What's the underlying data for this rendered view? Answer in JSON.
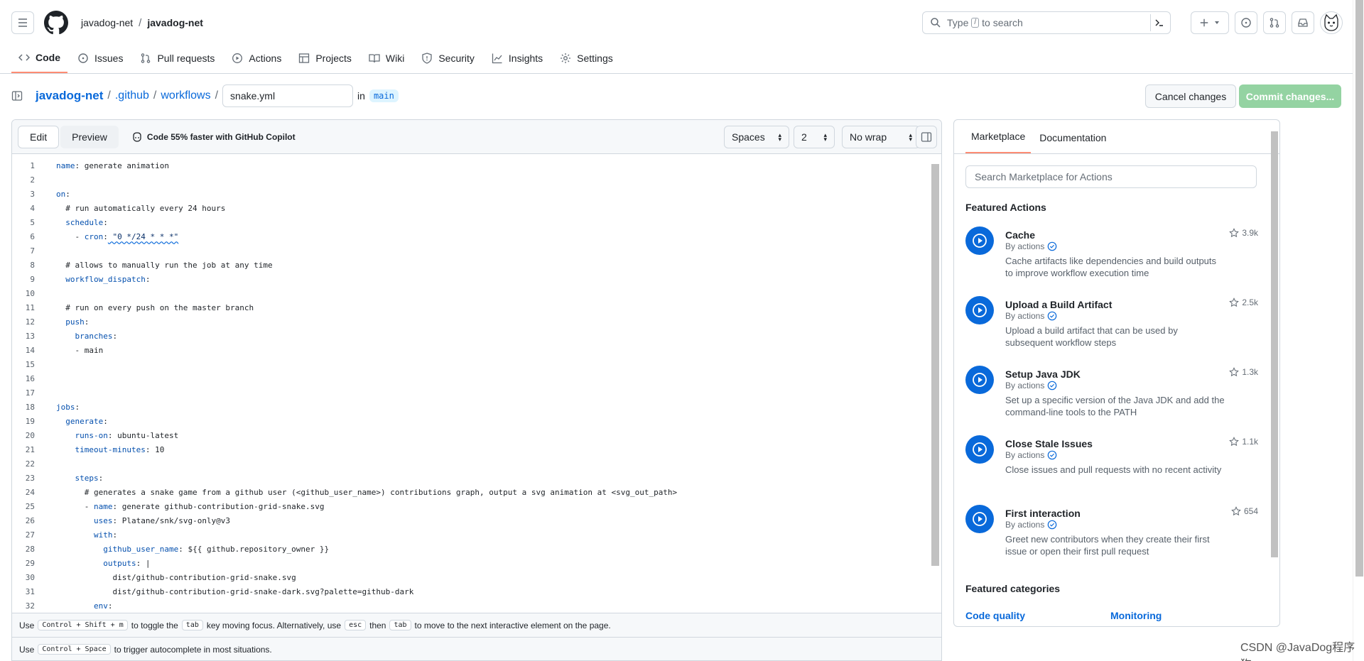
{
  "header": {
    "owner": "javadog-net",
    "repo": "javadog-net",
    "search_placeholder_prefix": "Type",
    "search_kbd": "/",
    "search_placeholder_suffix": "to search"
  },
  "repo_nav": [
    {
      "label": "Code",
      "icon": "code-icon",
      "active": true
    },
    {
      "label": "Issues",
      "icon": "issue-icon"
    },
    {
      "label": "Pull requests",
      "icon": "pull-request-icon"
    },
    {
      "label": "Actions",
      "icon": "play-icon"
    },
    {
      "label": "Projects",
      "icon": "table-icon"
    },
    {
      "label": "Wiki",
      "icon": "book-icon"
    },
    {
      "label": "Security",
      "icon": "shield-icon"
    },
    {
      "label": "Insights",
      "icon": "graph-icon"
    },
    {
      "label": "Settings",
      "icon": "gear-icon"
    }
  ],
  "path": {
    "root": "javadog-net",
    "dir1": ".github",
    "dir2": "workflows",
    "filename": "snake.yml",
    "in_label": "in",
    "branch": "main"
  },
  "actions_bar": {
    "cancel": "Cancel changes",
    "commit": "Commit changes..."
  },
  "editor": {
    "tab_edit": "Edit",
    "tab_preview": "Preview",
    "copilot": "Code 55% faster with GitHub Copilot",
    "indent_mode": "Spaces",
    "indent_size": "2",
    "wrap_mode": "No wrap",
    "lines": [
      "name: generate animation",
      "",
      "on:",
      "  # run automatically every 24 hours",
      "  schedule:",
      "    - cron: \"0 */24 * * *\"",
      "",
      "  # allows to manually run the job at any time",
      "  workflow_dispatch:",
      "",
      "  # run on every push on the master branch",
      "  push:",
      "    branches:",
      "    - main",
      "",
      "",
      "",
      "jobs:",
      "  generate:",
      "    runs-on: ubuntu-latest",
      "    timeout-minutes: 10",
      "",
      "    steps:",
      "      # generates a snake game from a github user (<github_user_name>) contributions graph, output a svg animation at <svg_out_path>",
      "      - name: generate github-contribution-grid-snake.svg",
      "        uses: Platane/snk/svg-only@v3",
      "        with:",
      "          github_user_name: ${{ github.repository_owner }}",
      "          outputs: |",
      "            dist/github-contribution-grid-snake.svg",
      "            dist/github-contribution-grid-snake-dark.svg?palette=github-dark",
      "        env:"
    ],
    "hint1": {
      "use": "Use",
      "kbd1": "Control + Shift + m",
      "mid": "to toggle the",
      "kbd2": "tab",
      "mid2": "key moving focus. Alternatively, use",
      "kbd3": "esc",
      "then": "then",
      "kbd4": "tab",
      "end": "to move to the next interactive element on the page."
    },
    "hint2": {
      "use": "Use",
      "kbd1": "Control + Space",
      "end": "to trigger autocomplete in most situations."
    }
  },
  "marketplace": {
    "tab_marketplace": "Marketplace",
    "tab_documentation": "Documentation",
    "search_placeholder": "Search Marketplace for Actions",
    "featured_actions": "Featured Actions",
    "featured_categories": "Featured categories",
    "actions": [
      {
        "name": "Cache",
        "by": "By actions",
        "desc": "Cache artifacts like dependencies and build outputs to improve workflow execution time",
        "stars": "3.9k"
      },
      {
        "name": "Upload a Build Artifact",
        "by": "By actions",
        "desc": "Upload a build artifact that can be used by subsequent workflow steps",
        "stars": "2.5k"
      },
      {
        "name": "Setup Java JDK",
        "by": "By actions",
        "desc": "Set up a specific version of the Java JDK and add the command-line tools to the PATH",
        "stars": "1.3k"
      },
      {
        "name": "Close Stale Issues",
        "by": "By actions",
        "desc": "Close issues and pull requests with no recent activity",
        "stars": "1.1k"
      },
      {
        "name": "First interaction",
        "by": "By actions",
        "desc": "Greet new contributors when they create their first issue or open their first pull request",
        "stars": "654"
      }
    ],
    "categories": [
      "Code quality",
      "Monitoring"
    ]
  },
  "watermark": "CSDN @JavaDog程序狗",
  "colors": {
    "accent": "#0969da",
    "nav_underline": "#fd8c73",
    "commit_disabled": "#94d3a2"
  }
}
